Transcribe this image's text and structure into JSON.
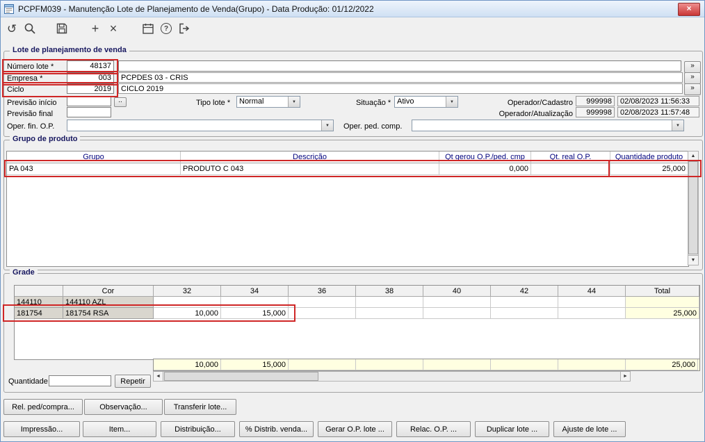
{
  "window": {
    "title": "PCPFM039 - Manutenção Lote de Planejamento de Venda(Grupo) - Data Produção: 01/12/2022"
  },
  "glyphs": {
    "refresh": "↺",
    "add": "+",
    "delete": "×",
    "help": "?",
    "close": "×",
    "more": "»",
    "down": "▼",
    "up": "▲",
    "left": "◄",
    "right": "►",
    "dots": ".."
  },
  "lote": {
    "legend": "Lote de planejamento de venda",
    "numero_lote": {
      "label": "Número lote *",
      "value": "48137"
    },
    "lote_descricao": "",
    "empresa": {
      "label": "Empresa *",
      "value": "003",
      "descricao": "PCPDES 03 - CRIS"
    },
    "ciclo": {
      "label": "Ciclo",
      "value": "2019",
      "descricao": "CICLO 2019"
    },
    "previsao_inicio": {
      "label": "Previsão início",
      "value": ""
    },
    "previsao_final": {
      "label": "Previsão final",
      "value": ""
    },
    "tipo_lote": {
      "label": "Tipo lote *",
      "value": "Normal"
    },
    "situacao": {
      "label": "Situação *",
      "value": "Ativo"
    },
    "operador_cadastro": {
      "label": "Operador/Cadastro",
      "codigo": "999998",
      "datahora": "02/08/2023 11:56:33"
    },
    "operador_atualizacao": {
      "label": "Operador/Atualização",
      "codigo": "999998",
      "datahora": "02/08/2023 11:57:48"
    },
    "oper_fin_op": {
      "label": "Oper. fin. O.P.",
      "value": ""
    },
    "oper_ped_comp": {
      "label": "Oper. ped. comp.",
      "value": ""
    }
  },
  "grupo_produto": {
    "legend": "Grupo de produto",
    "columns": [
      "Grupo",
      "Descrição",
      "Qt gerou O.P./ped. cmp",
      "Qt. real O.P.",
      "Quantidade produto"
    ],
    "rows": [
      {
        "grupo": "PA 043",
        "descricao": "PRODUTO C 043",
        "qt_gerou": "0,000",
        "qt_real": "",
        "quantidade": "25,000"
      }
    ]
  },
  "grade": {
    "legend": "Grade",
    "columns": [
      "",
      "Cor",
      "32",
      "34",
      "36",
      "38",
      "40",
      "42",
      "44",
      "Total"
    ],
    "rows": [
      {
        "codigo": "144110",
        "cor": "144110 AZL",
        "sizes": [
          "",
          "",
          "",
          "",
          "",
          "",
          ""
        ],
        "total": ""
      },
      {
        "codigo": "181754",
        "cor": "181754 RSA",
        "sizes": [
          "10,000",
          "15,000",
          "",
          "",
          "",
          "",
          ""
        ],
        "total": "25,000"
      }
    ],
    "totais": {
      "sizes": [
        "10,000",
        "15,000",
        "",
        "",
        "",
        "",
        ""
      ],
      "total": "25,000"
    },
    "quantidade": {
      "label": "Quantidade",
      "value": ""
    },
    "repetir_label": "Repetir"
  },
  "footer": {
    "row1": [
      "Rel. ped/compra...",
      "Observação...",
      "Transferir lote..."
    ],
    "row2": [
      "Impressão...",
      "Item...",
      "Distribuição...",
      "% Distrib. venda...",
      "Gerar O.P. lote ...",
      "Relac. O.P. ...",
      "Duplicar lote ...",
      "Ajuste de lote ..."
    ]
  }
}
